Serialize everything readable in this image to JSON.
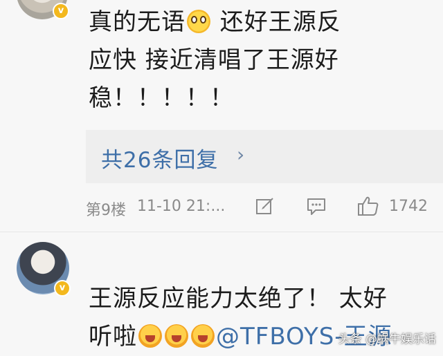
{
  "comment1": {
    "line1_a": "真的无语",
    "emoji1": "flushed-face-emoji",
    "line1_b": " 还好王源反",
    "line2": "应快 接近清唱了王源好",
    "line3": "稳！！！！！",
    "replies_label": "共26条回复",
    "replies_chevron": "›",
    "floor": "第9楼",
    "timestamp": "11-10 21:...",
    "like_count": "1742"
  },
  "comment2": {
    "line1": "王源反应能力太绝了！ 太好",
    "line2_a": "听啦",
    "emojis": [
      "crying-laughing-emoji",
      "crying-laughing-emoji",
      "crying-laughing-emoji"
    ],
    "mention": "@TFBOYS-王源"
  },
  "watermark": "头条 @蜗牛娱乐话",
  "colors": {
    "background": "#f7f7f7",
    "link": "#3e6fa8",
    "meta": "#8a8a8a",
    "badge": "#f3b81e"
  }
}
